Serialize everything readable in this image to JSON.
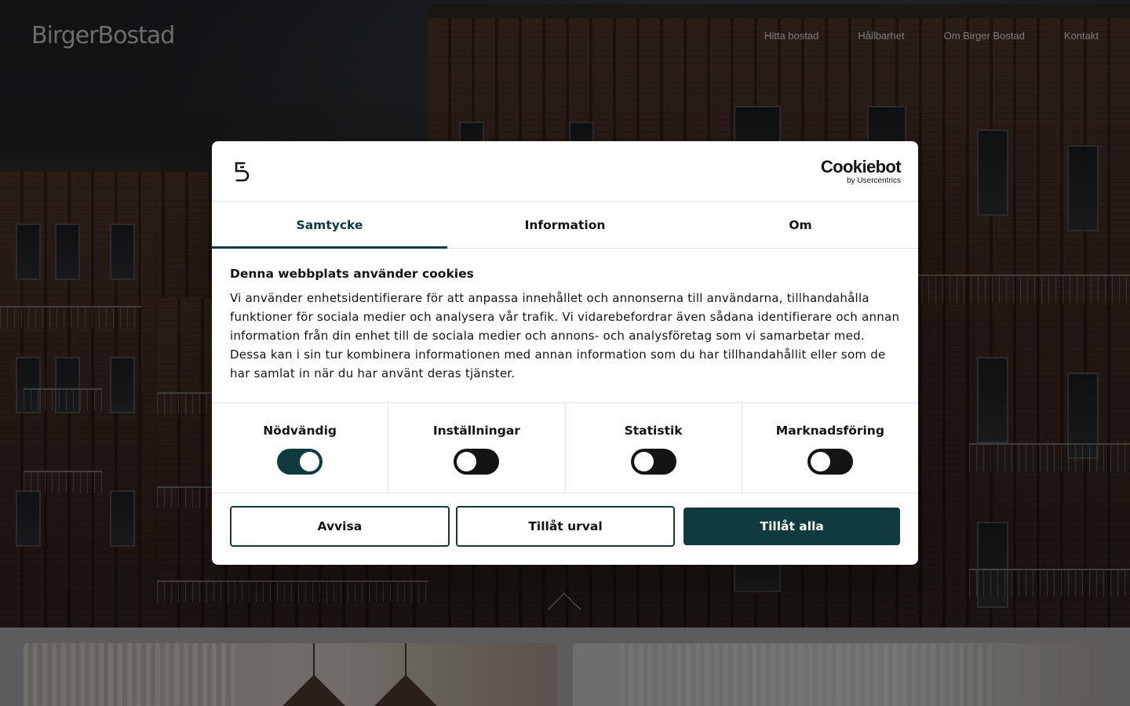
{
  "site": {
    "logo_text": "BirgerBostad",
    "nav": [
      {
        "label": "Hitta bostad"
      },
      {
        "label": "Hållbarhet"
      },
      {
        "label": "Om Birger Bostad"
      },
      {
        "label": "Kontakt"
      }
    ],
    "scroll_icon": "chevron-up-icon"
  },
  "dialog": {
    "brand_icon": "birger-bostad-mark-icon",
    "provider": {
      "name": "Cookiebot",
      "sub": "by Usercentrics"
    },
    "tabs": [
      {
        "label": "Samtycke",
        "active": true
      },
      {
        "label": "Information",
        "active": false
      },
      {
        "label": "Om",
        "active": false
      }
    ],
    "title": "Denna webbplats använder cookies",
    "text": "Vi använder enhetsidentifierare för att anpassa innehållet och annonserna till användarna, tillhandahålla funktioner för sociala medier och analysera vår trafik. Vi vidarebefordrar även sådana identifierare och annan information från din enhet till de sociala medier och annons- och analysföretag som vi samarbetar med. Dessa kan i sin tur kombinera informationen med annan information som du har tillhandahållit eller som de har samlat in när du har använt deras tjänster.",
    "categories": [
      {
        "label": "Nödvändig",
        "enabled": true
      },
      {
        "label": "Inställningar",
        "enabled": false
      },
      {
        "label": "Statistik",
        "enabled": false
      },
      {
        "label": "Marknadsföring",
        "enabled": false
      }
    ],
    "buttons": {
      "reject": "Avvisa",
      "allow_selection": "Tillåt urval",
      "allow_all": "Tillåt alla"
    },
    "colors": {
      "accent": "#0f3a40",
      "toggle_off": "#141414"
    }
  }
}
